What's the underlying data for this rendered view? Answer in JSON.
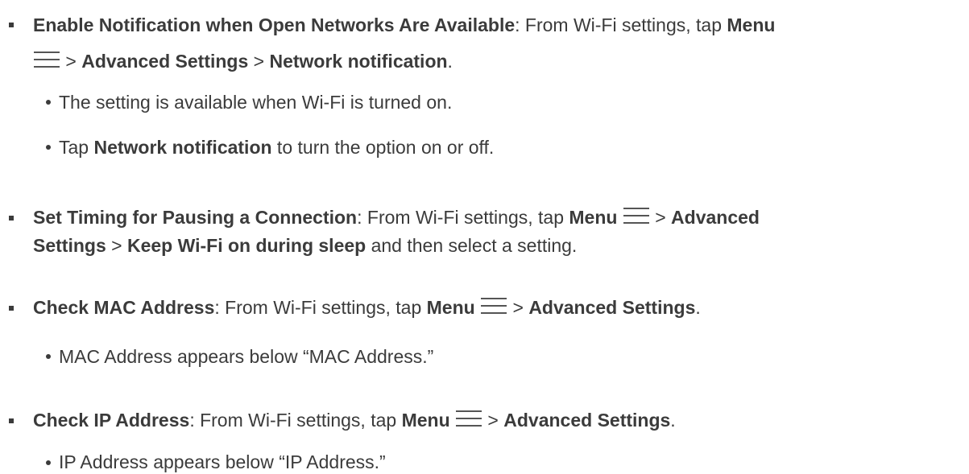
{
  "icons": {
    "menu": "hamburger-menu-icon"
  },
  "items": [
    {
      "title": "Enable Notification when Open Networks Are Available",
      "text_1": ": From Wi-Fi settings, tap ",
      "menu": "Menu",
      "sep_1": " > ",
      "adv": "Advanced Settings",
      "sep_2": " > ",
      "target": "Network notification",
      "end": ".",
      "subs": [
        "The setting is available when Wi-Fi is turned on.",
        {
          "pre": "Tap ",
          "bold": "Network notification",
          "post": " to turn the option on or off."
        }
      ]
    },
    {
      "title": "Set Timing for Pausing a Connection",
      "text_1": ": From Wi-Fi settings, tap ",
      "menu": "Menu",
      "sep_1": " > ",
      "adv_1": "Advanced",
      "adv_2": "Settings",
      "sep_2": " > ",
      "target": "Keep Wi-Fi on during sleep",
      "end": " and then select a setting."
    },
    {
      "title": "Check MAC Address",
      "text_1": ": From Wi-Fi settings, tap ",
      "menu": "Menu",
      "sep_1": " > ",
      "adv": "Advanced Settings",
      "end": ".",
      "sub": "MAC Address appears below “MAC Address.”"
    },
    {
      "title": "Check IP Address",
      "text_1": ": From Wi-Fi settings, tap ",
      "menu": "Menu",
      "sep_1": " > ",
      "adv": "Advanced Settings",
      "end": ".",
      "sub": "IP Address appears below “IP Address.”"
    }
  ]
}
